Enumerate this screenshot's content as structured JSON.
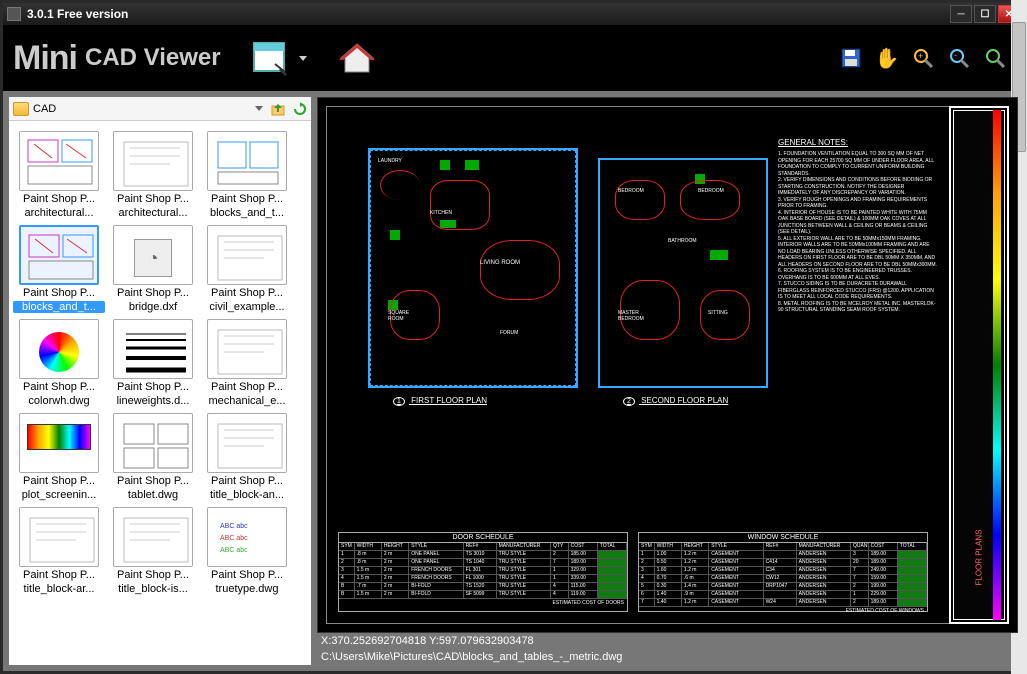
{
  "window": {
    "title": "3.0.1 Free version"
  },
  "logo": {
    "main": "Mini",
    "sub": "CAD Viewer"
  },
  "folder": {
    "name": "CAD"
  },
  "thumbs": [
    {
      "type": "Paint Shop P...",
      "file": "architectural..."
    },
    {
      "type": "Paint Shop P...",
      "file": "architectural..."
    },
    {
      "type": "Paint Shop P...",
      "file": "blocks_and_t..."
    },
    {
      "type": "Paint Shop P...",
      "file": "blocks_and_t...",
      "selected": true
    },
    {
      "type": "Paint Shop P...",
      "file": "bridge.dxf"
    },
    {
      "type": "Paint Shop P...",
      "file": "civil_example..."
    },
    {
      "type": "Paint Shop P...",
      "file": "colorwh.dwg"
    },
    {
      "type": "Paint Shop P...",
      "file": "lineweights.d..."
    },
    {
      "type": "Paint Shop P...",
      "file": "mechanical_e..."
    },
    {
      "type": "Paint Shop P...",
      "file": "plot_screenin..."
    },
    {
      "type": "Paint Shop P...",
      "file": "tablet.dwg"
    },
    {
      "type": "Paint Shop P...",
      "file": "title_block-an..."
    },
    {
      "type": "Paint Shop P...",
      "file": "title_block-ar..."
    },
    {
      "type": "Paint Shop P...",
      "file": "title_block-is..."
    },
    {
      "type": "Paint Shop P...",
      "file": "truetype.dwg"
    }
  ],
  "drawing": {
    "notes_header": "GENERAL NOTES:",
    "plan1": "FIRST FLOOR PLAN",
    "plan2": "SECOND FLOOR PLAN",
    "rooms1": [
      "LAUNDRY",
      "KITCHEN",
      "LIVING ROOM",
      "SQUARE ROOM",
      "FORUM"
    ],
    "rooms2": [
      "BEDROOM",
      "BEDROOM",
      "BATHROOM",
      "MASTER BEDROOM",
      "SITTING"
    ],
    "door_sched": {
      "title": "DOOR SCHEDULE",
      "headers": [
        "SYM",
        "WIDTH",
        "HEIGHT",
        "STYLE",
        "REF#",
        "MANUFACTURER",
        "QTY",
        "COST",
        "TOTAL"
      ],
      "rows": [
        [
          "1",
          ".8 m",
          "2 m",
          "ONE PANEL",
          "TS 3010",
          "TRU STYLE",
          "2",
          "185.00",
          ""
        ],
        [
          "2",
          ".8 m",
          "2 m",
          "ONE PANEL",
          "TS 1040",
          "TRU STYLE",
          "7",
          "189.00",
          ""
        ],
        [
          "3",
          "1.5 m",
          "2 m",
          "FRENCH DOORS",
          "FL 301",
          "TRU STYLE",
          "1",
          "329.00",
          ""
        ],
        [
          "4",
          "1.5 m",
          "2 m",
          "FRENCH DOORS",
          "FL 1000",
          "TRU STYLE",
          "1",
          "339.00",
          ""
        ],
        [
          "B",
          ".7 m",
          "2 m",
          "BI-FOLD",
          "TS 1520",
          "TRU STYLE",
          "4",
          "115.00",
          ""
        ],
        [
          "B",
          "1.5 m",
          "2 m",
          "BI-FOLD",
          "SF 5099",
          "TRU STYLE",
          "4",
          "119.00",
          ""
        ]
      ],
      "footer": "ESTIMATED COST OF DOORS"
    },
    "window_sched": {
      "title": "WINDOW SCHEDULE",
      "headers": [
        "SYM",
        "WIDTH",
        "HEIGHT",
        "STYLE",
        "REF#",
        "MANUFACTURER",
        "QUANTITY",
        "COST",
        "TOTAL"
      ],
      "rows": [
        [
          "1",
          "1.00",
          "1.2 m",
          "CASEMENT",
          "",
          "ANDERSEN",
          "3",
          "189.00",
          ""
        ],
        [
          "2",
          "0.50",
          "1.2 m",
          "CASEMENT",
          "C414",
          "ANDERSEN",
          "20",
          "189.00",
          ""
        ],
        [
          "3",
          "1.60",
          "1.2 m",
          "CASEMENT",
          "C34",
          "ANDERSEN",
          "7",
          "249.00",
          ""
        ],
        [
          "4",
          "0.70",
          ".6 m",
          "CASEMENT",
          "CW12",
          "ANDERSEN",
          "7",
          "159.00",
          ""
        ],
        [
          "5",
          "0.30",
          "1.4 m",
          "CASEMENT",
          "DRP1047",
          "ANDERSEN",
          "2",
          "199.00",
          ""
        ],
        [
          "6",
          "1.40",
          ".9 m",
          "CASEMENT",
          "",
          "ANDERSEN",
          "1",
          "229.00",
          ""
        ],
        [
          "7",
          "1.40",
          "1.2 m",
          "CASEMENT",
          "W24",
          "ANDERSEN",
          "2",
          "189.00",
          ""
        ]
      ],
      "footer": "ESTIMATED COST OF WINDOWS"
    },
    "title_block_label": "FLOOR PLANS"
  },
  "status": {
    "coords": "X:370.252692704818  Y:597.079632903478",
    "path": "C:\\Users\\Mike\\Pictures\\CAD\\blocks_and_tables_-_metric.dwg"
  }
}
